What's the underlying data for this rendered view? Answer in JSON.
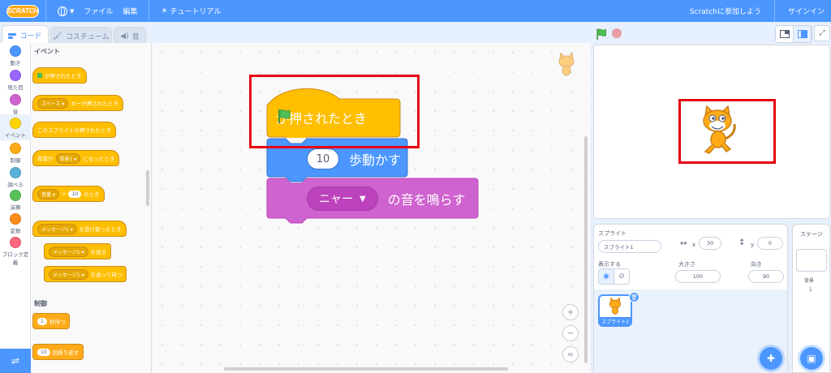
{
  "menubar": {
    "logo": "SCRATCH",
    "file": "ファイル",
    "edit": "編集",
    "tutorial": "チュートリアル",
    "join": "Scratchに参加しよう",
    "signin": "サインイン"
  },
  "tabs": {
    "code": "コード",
    "costume": "コスチューム",
    "sound": "音"
  },
  "categories": [
    {
      "label": "動き",
      "color": "#4c97ff"
    },
    {
      "label": "見た目",
      "color": "#9966ff"
    },
    {
      "label": "音",
      "color": "#cf63cf"
    },
    {
      "label": "イベント",
      "color": "#ffd500"
    },
    {
      "label": "制御",
      "color": "#ffab19"
    },
    {
      "label": "調べる",
      "color": "#5cb1d6"
    },
    {
      "label": "演算",
      "color": "#59c059"
    },
    {
      "label": "変数",
      "color": "#ff8c1a"
    },
    {
      "label": "ブロック定義",
      "color": "#ff6680"
    }
  ],
  "palette": {
    "events_title": "イベント",
    "control_title": "制御",
    "b_flag": "が押されたとき",
    "b_key_dd": "スペース",
    "b_key": "キーが押されたとき",
    "b_sprite_click": "このスプライトが押されたとき",
    "b_backdrop_pre": "背景が",
    "b_backdrop_dd": "背景1",
    "b_backdrop_post": "になったとき",
    "b_loud_dd": "音量",
    "b_loud_op": ">",
    "b_loud_val": "10",
    "b_loud_post": "のとき",
    "b_recv_dd": "メッセージ1",
    "b_recv": "を受け取ったとき",
    "b_send_dd": "メッセージ1",
    "b_send": "を送る",
    "b_sendwait_dd": "メッセージ1",
    "b_sendwait": "を送って待つ",
    "b_wait_val": "1",
    "b_wait": "秒待つ",
    "b_repeat_val": "10",
    "b_repeat": "回繰り返す"
  },
  "workspace": {
    "hat_label": "が押されたとき",
    "move_value": "10",
    "move_label": "歩動かす",
    "sound_dd": "ニャー",
    "sound_label": "の音を鳴らす",
    "zoom_in": "+",
    "zoom_out": "−",
    "zoom_reset": "="
  },
  "sprite_info": {
    "sprite_label": "スプライト",
    "sprite_name": "スプライト1",
    "x_label": "x",
    "x_value": "30",
    "y_label": "y",
    "y_value": "0",
    "show_label": "表示する",
    "size_label": "大きさ",
    "size_value": "100",
    "direction_label": "向き",
    "direction_value": "90",
    "tile_name": "スプライト1"
  },
  "stage_panel": {
    "title": "ステージ",
    "backdrop_label": "背景",
    "backdrop_count": "1"
  },
  "colors": {
    "menubar": "#4c97ff",
    "events": "#ffbf00",
    "motion": "#4c97ff",
    "sound": "#cf63cf",
    "highlight": "#e60012"
  }
}
